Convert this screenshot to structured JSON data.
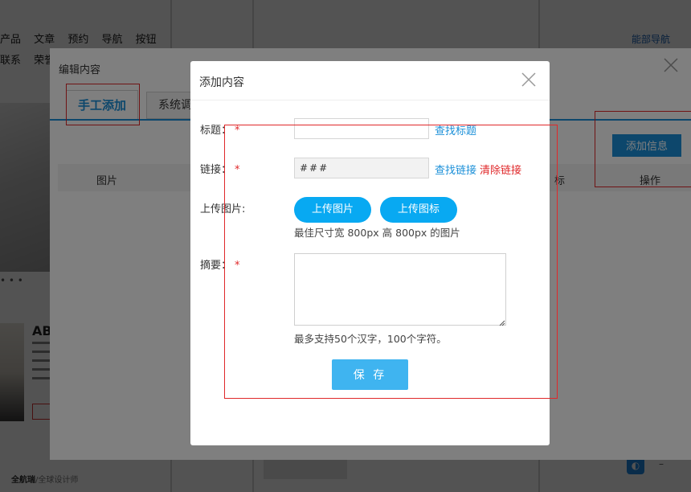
{
  "background": {
    "nav_row_1": [
      "产品",
      "文章",
      "预约",
      "导航",
      "按钮"
    ],
    "nav_row_2": [
      "联系",
      "荣誉"
    ],
    "top_right_link": "能部导航",
    "dots": "• • •",
    "ab_text": "AB",
    "footer_brand": "全航瑞",
    "footer_text": "/全球设计师"
  },
  "outer_dialog": {
    "title": "编辑内容",
    "tab_active": "手工添加",
    "tab_other": "系统调",
    "add_button": "添加信息",
    "col_image": "图片",
    "col_partial": "标",
    "col_operation": "操作"
  },
  "form_dialog": {
    "title": "添加内容",
    "title_field": {
      "label": "标题：",
      "required_mark": "*",
      "value": "",
      "link": "查找标题"
    },
    "link_field": {
      "label": "链接：",
      "required_mark": "*",
      "value": "###",
      "find_link": "查找链接",
      "clear_link": "清除链接"
    },
    "upload_field": {
      "label": "上传图片:",
      "upload_image_button": "上传图片",
      "upload_icon_button": "上传图标",
      "hint": "最佳尺寸宽 800px 高 800px 的图片"
    },
    "summary_field": {
      "label": "摘要：",
      "required_mark": "*",
      "value": "",
      "hint": "最多支持50个汉字，100个字符。"
    },
    "save_button": "保 存"
  },
  "colors": {
    "accent": "#1a8fd8",
    "pill_button": "#08a9f2",
    "save_button": "#3fb4f0",
    "required": "#e0282a",
    "annotation": "#e0282a"
  }
}
